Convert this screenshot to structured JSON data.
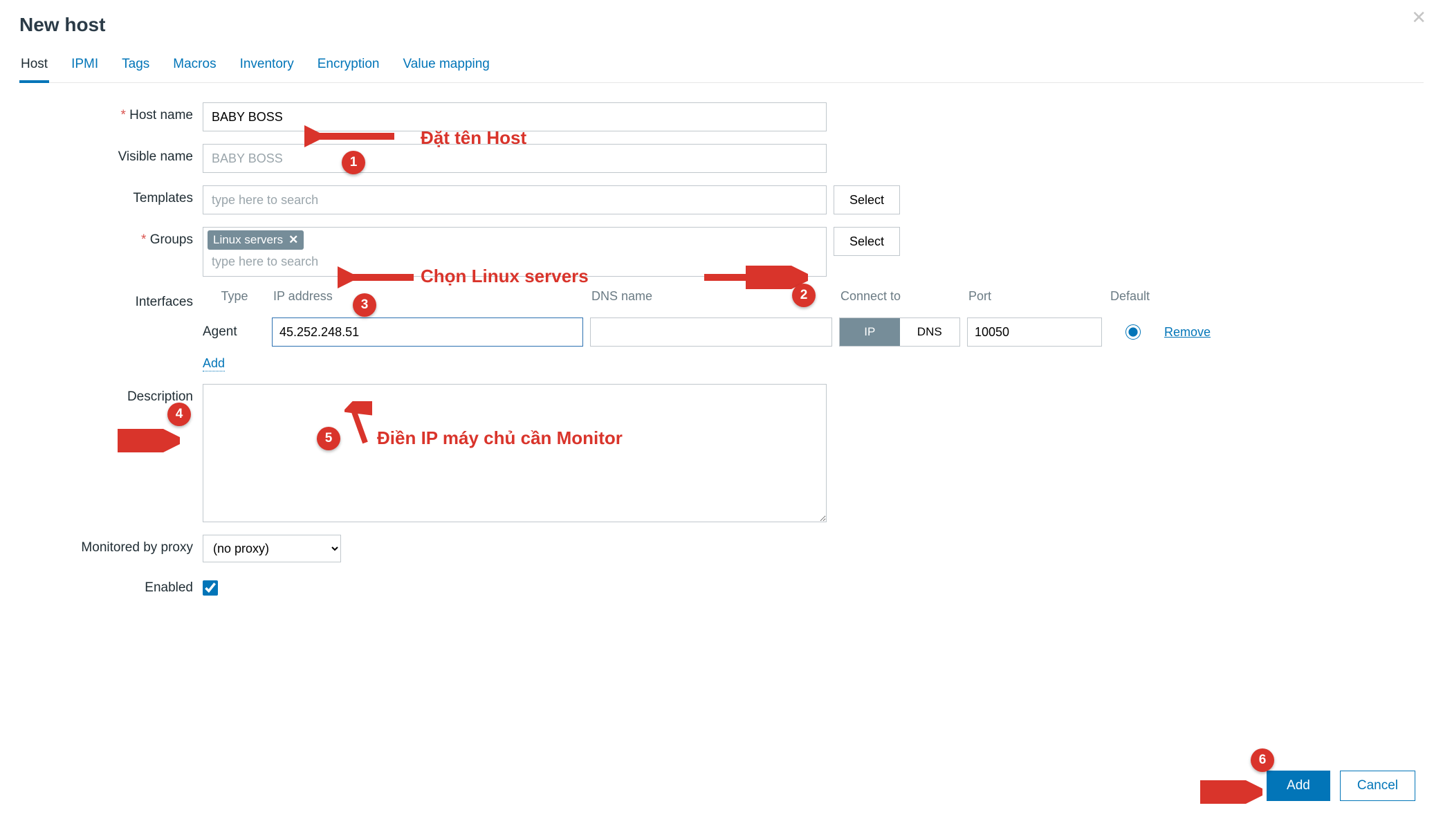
{
  "page": {
    "title": "New host"
  },
  "tabs": {
    "host": "Host",
    "ipmi": "IPMI",
    "tags": "Tags",
    "macros": "Macros",
    "inventory": "Inventory",
    "encryption": "Encryption",
    "value_mapping": "Value mapping"
  },
  "labels": {
    "host_name": "Host name",
    "visible_name": "Visible name",
    "templates": "Templates",
    "groups": "Groups",
    "interfaces": "Interfaces",
    "description": "Description",
    "monitored_by_proxy": "Monitored by proxy",
    "enabled": "Enabled"
  },
  "fields": {
    "host_name": "BABY BOSS",
    "visible_name_placeholder": "BABY BOSS",
    "templates_placeholder": "type here to search",
    "select_label": "Select",
    "groups_tag": "Linux servers",
    "groups_search_placeholder": "type here to search",
    "proxy_selected": "(no proxy)",
    "enabled_checked": true
  },
  "interfaces": {
    "headers": {
      "type": "Type",
      "ip": "IP address",
      "dns": "DNS name",
      "connect_to": "Connect to",
      "port": "Port",
      "default": "Default"
    },
    "row": {
      "type_label": "Agent",
      "ip_value": "45.252.248.51",
      "dns_value": "",
      "toggle_ip": "IP",
      "toggle_dns": "DNS",
      "port_value": "10050",
      "remove_label": "Remove"
    },
    "add_label": "Add"
  },
  "footer": {
    "add": "Add",
    "cancel": "Cancel"
  },
  "annotations": {
    "t1": "Đặt tên Host",
    "t2": "Chọn Linux servers",
    "t5": "Điền IP máy chủ cần Monitor",
    "b1": "1",
    "b2": "2",
    "b3": "3",
    "b4": "4",
    "b5": "5",
    "b6": "6"
  }
}
